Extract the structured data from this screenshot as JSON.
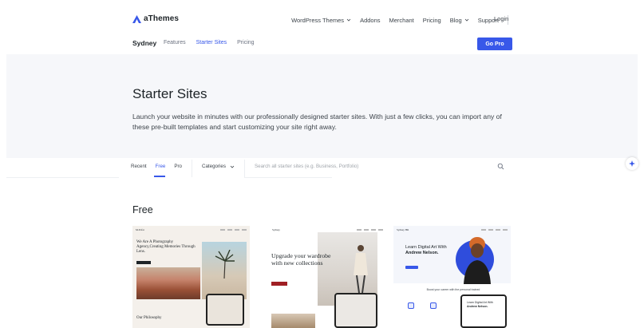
{
  "header": {
    "logo_text": "aThemes",
    "nav": [
      {
        "label": "WordPress Themes",
        "has_dropdown": true
      },
      {
        "label": "Addons",
        "has_dropdown": false
      },
      {
        "label": "Merchant",
        "has_dropdown": false
      },
      {
        "label": "Pricing",
        "has_dropdown": false
      },
      {
        "label": "Blog",
        "has_dropdown": true
      },
      {
        "label": "Support",
        "has_dropdown": false
      }
    ],
    "login_label": "Login"
  },
  "subnav": {
    "brand": "Sydney",
    "links": [
      "Features",
      "Starter Sites",
      "Pricing"
    ],
    "active_link": "Starter Sites",
    "cta_label": "Go Pro"
  },
  "hero": {
    "title": "Starter Sites",
    "description": "Launch your website in minutes with our professionally designed starter sites. With just a few clicks, you can import any of these pre-built templates and start customizing your site right away."
  },
  "filters": {
    "tabs": [
      "Recent",
      "Free",
      "Pro"
    ],
    "active_tab": "Free",
    "categories_label": "Categories",
    "search_placeholder": "Search all starter sites (e.g. Business, Portfolio)"
  },
  "section": {
    "title": "Free"
  },
  "cards": [
    {
      "logo": "M.Pofar",
      "headline": "We Are A Photography Agency,Creating Memories Through Lens.",
      "footer": "Our Philosophy"
    },
    {
      "logo": "Sydney",
      "headline": "Upgrade your wardrobe with new collections"
    },
    {
      "logo": "Sydney HR",
      "headline_prefix": "Learn Digital Art With",
      "headline_name": "Andrew Nelson.",
      "mid_text": "Boost your career with the personal trained",
      "phone_text_prefix": "Learn Digital Art With",
      "phone_text_name": "Andrew Nelson."
    }
  ],
  "colors": {
    "accent": "#3858e9",
    "hero_bg": "#f6f7fa",
    "text": "#1d2327",
    "muted": "#6b7280"
  }
}
